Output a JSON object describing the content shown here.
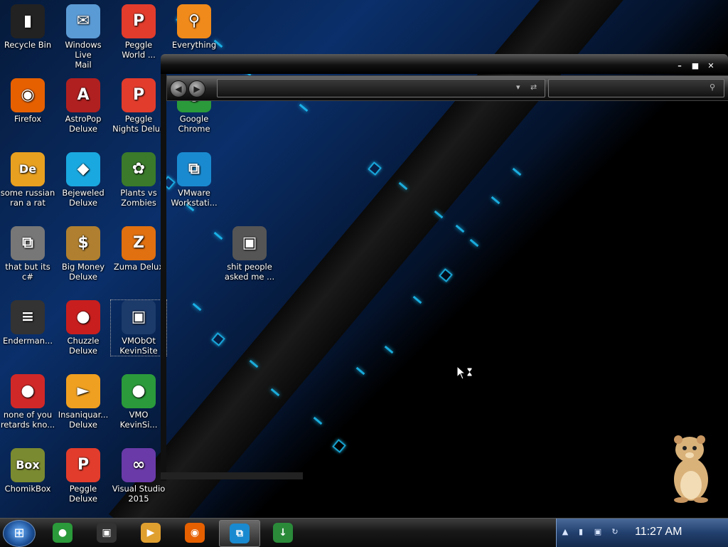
{
  "desktop": {
    "icons": [
      {
        "label": "Recycle Bin",
        "icon": "recycle-bin-icon"
      },
      {
        "label": "Windows Live\nMail",
        "icon": "mail-icon"
      },
      {
        "label": "Peggle\nWorld ...",
        "icon": "peggle-icon"
      },
      {
        "label": "Everything",
        "icon": "search-icon"
      },
      {
        "label": "Firefox",
        "icon": "firefox-icon"
      },
      {
        "label": "AstroPop\nDeluxe",
        "icon": "astropop-icon"
      },
      {
        "label": "Peggle\nNights Delux",
        "icon": "peggle-icon"
      },
      {
        "label": "Google\nChrome",
        "icon": "chrome-icon"
      },
      {
        "label": "some russian\nran a rat",
        "icon": "de-icon"
      },
      {
        "label": "Bejeweled\nDeluxe",
        "icon": "gem-icon"
      },
      {
        "label": "Plants vs\nZombies",
        "icon": "flower-icon"
      },
      {
        "label": "VMware\nWorkstati...",
        "icon": "vmware-icon"
      },
      {
        "label": "that but its\nc#",
        "icon": "windows-stack-icon"
      },
      {
        "label": "Big Money\nDeluxe",
        "icon": "money-bag-icon"
      },
      {
        "label": "Zuma Delux",
        "icon": "zuma-icon"
      },
      {
        "label": "shit people\nasked me ...",
        "icon": "folder-icon"
      },
      {
        "label": "Enderman...",
        "icon": "console-icon"
      },
      {
        "label": "Chuzzle\nDeluxe",
        "icon": "chuzzle-icon"
      },
      {
        "label": "VMObOt\nKevinSite",
        "icon": "vm-folder-icon"
      },
      {
        "label": "none of you\nretards kno...",
        "icon": "dragon-icon"
      },
      {
        "label": "Insaniquar...\nDeluxe",
        "icon": "fish-icon"
      },
      {
        "label": "VMO\nKevinSi...",
        "icon": "chrome-icon"
      },
      {
        "label": "ChomikBox",
        "icon": "chomikbox-icon"
      },
      {
        "label": "Peggle\nDeluxe",
        "icon": "peggle-icon"
      },
      {
        "label": "Visual Studio\n2015",
        "icon": "visual-studio-icon"
      }
    ]
  },
  "window": {
    "controls": {
      "minimize": "–",
      "maximize": "■",
      "close": "✕"
    },
    "address_value": "",
    "search_value": ""
  },
  "taskbar": {
    "start_glyph": "⊞",
    "pinned": [
      {
        "name": "chrome",
        "icon": "chrome-icon"
      },
      {
        "name": "folder",
        "icon": "dark-folder-icon"
      },
      {
        "name": "media player",
        "icon": "media-player-icon"
      },
      {
        "name": "firefox",
        "icon": "firefox-icon"
      },
      {
        "name": "vmware",
        "icon": "vmware-icon",
        "active": true
      },
      {
        "name": "download manager",
        "icon": "download-manager-icon"
      }
    ],
    "clock": "11:27 AM"
  },
  "colors": {
    "accent": "#1ec8ff",
    "tray": "#22406e"
  }
}
